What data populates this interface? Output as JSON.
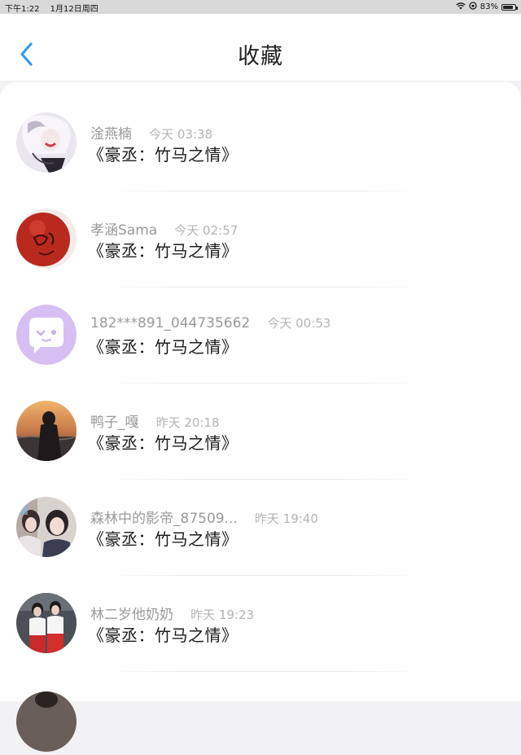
{
  "status_bar": {
    "time": "下午1:22",
    "date": "1月12日周四",
    "battery_percent": "83%",
    "battery_level": 0.83
  },
  "nav": {
    "title": "收藏",
    "back_icon": "chevron-left-icon",
    "accent_color": "#2f9cf0"
  },
  "favorites": [
    {
      "user": "淦燕楠",
      "time": "今天 03:38",
      "title": "《豪丞：竹马之情》"
    },
    {
      "user": "孝涵Sama",
      "time": "今天 02:57",
      "title": "《豪丞：竹马之情》"
    },
    {
      "user": "182***891_044735662",
      "time": "今天 00:53",
      "title": "《豪丞：竹马之情》"
    },
    {
      "user": "鸭子_嘎",
      "time": "昨天 20:18",
      "title": "《豪丞：竹马之情》"
    },
    {
      "user": "森林中的影帝_87509...",
      "time": "昨天 19:40",
      "title": "《豪丞：竹马之情》"
    },
    {
      "user": "林二岁他奶奶",
      "time": "昨天 19:23",
      "title": "《豪丞：竹马之情》"
    }
  ]
}
